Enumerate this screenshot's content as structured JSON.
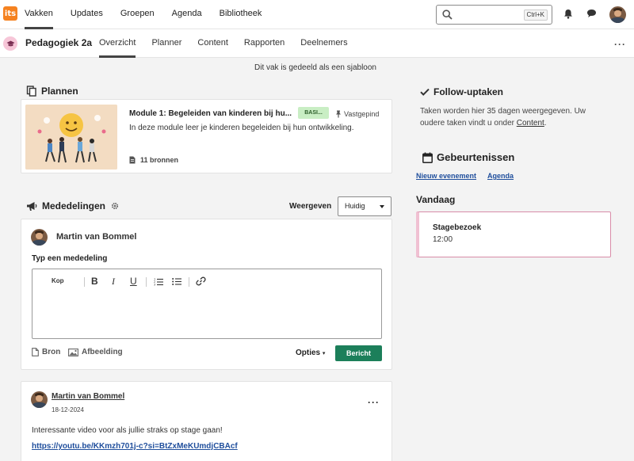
{
  "topbar": {
    "logo_text": "its",
    "nav": [
      {
        "label": "Vakken",
        "active": true
      },
      {
        "label": "Updates"
      },
      {
        "label": "Groepen"
      },
      {
        "label": "Agenda"
      },
      {
        "label": "Bibliotheek"
      }
    ],
    "search": {
      "placeholder": "",
      "shortcut": "Ctrl+K"
    },
    "icons": [
      "search-icon",
      "bell-icon",
      "chat-icon",
      "user-avatar"
    ]
  },
  "course": {
    "title": "Pedagogiek 2a",
    "tabs": [
      {
        "label": "Overzicht",
        "active": true
      },
      {
        "label": "Planner"
      },
      {
        "label": "Content"
      },
      {
        "label": "Rapporten"
      },
      {
        "label": "Deelnemers"
      }
    ],
    "more": "···"
  },
  "template_note": "Dit vak is gedeeld als een sjabloon",
  "plannen": {
    "heading": "Plannen",
    "plan": {
      "title": "Module 1: Begeleiden van kinderen bij hu...",
      "badge": "BASI...",
      "pinned": "Vastgepind",
      "description": "In deze module leer je kinderen begeleiden bij hun ontwikkeling.",
      "resources": "11 bronnen"
    }
  },
  "mededelingen": {
    "heading": "Mededelingen",
    "weergeven_label": "Weergeven",
    "weergeven_value": "Huidig",
    "composer": {
      "author": "Martin van Bommel",
      "label": "Typ een mededeling",
      "toolbar": {
        "heading": "Kop",
        "bold": "B",
        "italic": "I",
        "underline": "U"
      },
      "attach_source": "Bron",
      "attach_image": "Afbeelding",
      "options": "Opties",
      "submit": "Bericht"
    }
  },
  "post": {
    "author": "Martin van Bommel",
    "date": "18-12-2024",
    "more": "···",
    "text": "Interessante video voor als jullie straks op stage gaan!",
    "link": "https://youtu.be/KKmzh701j-c?si=BtZxMeKUmdjCBAcf"
  },
  "follow_up": {
    "heading": "Follow-uptaken",
    "text": "Taken worden hier 35 dagen weergegeven. Uw oudere taken vindt u onder",
    "link": "Content",
    "text_end": "."
  },
  "events": {
    "heading": "Gebeurtenissen",
    "new_event": "Nieuw evenement",
    "agenda": "Agenda",
    "today_label": "Vandaag",
    "items": [
      {
        "title": "Stagebezoek",
        "time": "12:00"
      }
    ]
  },
  "colors": {
    "logo": "#f58220",
    "course_badge": "#f7c6d8",
    "tag_bg": "#c9eec4",
    "primary_button": "#1c7f5a",
    "link": "#1f4e9c",
    "event_border": "#d88ca8"
  }
}
